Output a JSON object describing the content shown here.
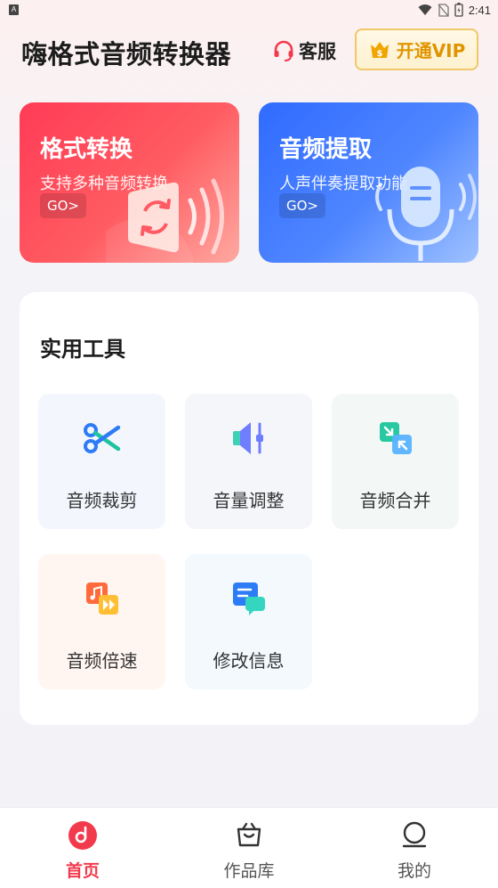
{
  "status_bar": {
    "time": "2:41"
  },
  "header": {
    "title": "嗨格式音频转换器",
    "service_label": "客服",
    "vip_label": "开通VIP"
  },
  "cards": [
    {
      "title": "格式转换",
      "subtitle": "支持多种音频转换",
      "go": "GO>"
    },
    {
      "title": "音频提取",
      "subtitle": "人声伴奏提取功能",
      "go": "GO>"
    }
  ],
  "tools": {
    "title": "实用工具",
    "items": [
      {
        "label": "音频裁剪",
        "icon": "scissors-icon"
      },
      {
        "label": "音量调整",
        "icon": "volume-adjust-icon"
      },
      {
        "label": "音频合并",
        "icon": "merge-icon"
      },
      {
        "label": "音频倍速",
        "icon": "speed-icon"
      },
      {
        "label": "修改信息",
        "icon": "edit-info-icon"
      }
    ]
  },
  "nav": {
    "items": [
      {
        "label": "首页",
        "icon": "home-icon",
        "active": true
      },
      {
        "label": "作品库",
        "icon": "works-icon",
        "active": false
      },
      {
        "label": "我的",
        "icon": "profile-icon",
        "active": false
      }
    ]
  },
  "colors": {
    "accent_red": "#f23a4d",
    "accent_blue": "#3a78ff",
    "vip_gold": "#e09500"
  }
}
